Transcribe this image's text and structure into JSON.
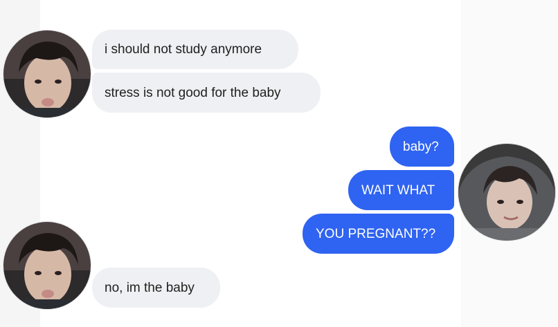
{
  "conversation": {
    "messages": [
      {
        "sender": "them",
        "text": "i should not study anymore"
      },
      {
        "sender": "them",
        "text": "stress is not good for the baby"
      },
      {
        "sender": "me",
        "text": "baby?"
      },
      {
        "sender": "me",
        "text": "WAIT WHAT"
      },
      {
        "sender": "me",
        "text": "YOU PREGNANT??"
      },
      {
        "sender": "them",
        "text": "no, im the baby"
      }
    ]
  },
  "colors": {
    "outgoing_bubble": "#2f63f1",
    "incoming_bubble": "#eff0f3",
    "outgoing_text": "#ffffff",
    "incoming_text": "#1f1f1f"
  }
}
